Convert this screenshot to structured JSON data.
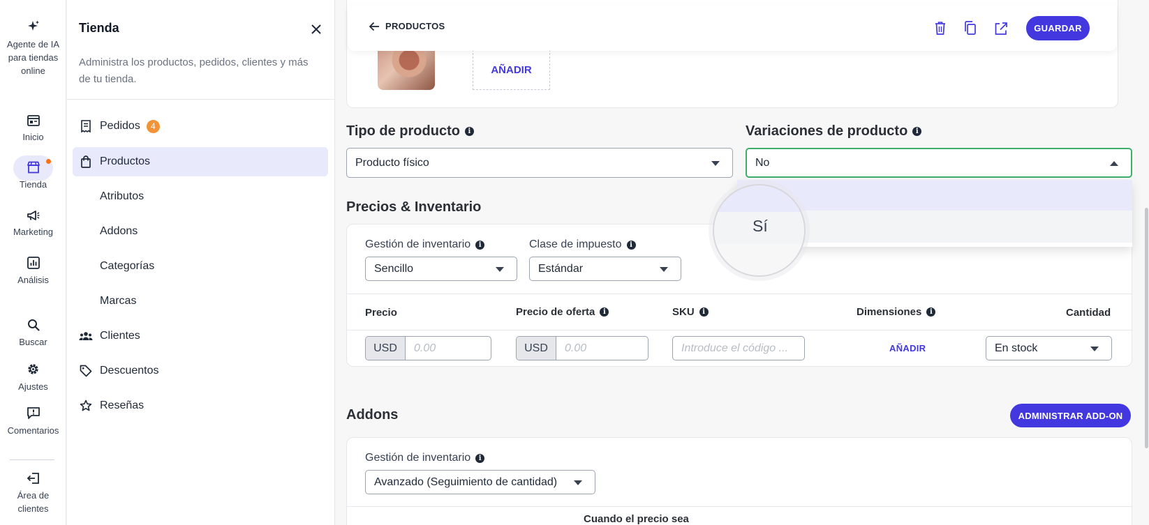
{
  "rail": {
    "items": [
      {
        "label": "Agente de IA para tiendas online",
        "icon": "sparkle-icon"
      },
      {
        "label": "Inicio",
        "icon": "home-dashboard-icon"
      },
      {
        "label": "Tienda",
        "icon": "store-icon"
      },
      {
        "label": "Marketing",
        "icon": "megaphone-icon"
      },
      {
        "label": "Análisis",
        "icon": "chart-icon"
      },
      {
        "label": "Buscar",
        "icon": "search-icon"
      },
      {
        "label": "Ajustes",
        "icon": "gear-icon"
      },
      {
        "label": "Comentarios",
        "icon": "feedback-icon"
      },
      {
        "label": "Área de clientes",
        "icon": "client-area-icon"
      }
    ]
  },
  "panel": {
    "title": "Tienda",
    "description": "Administra los productos, pedidos, clientes y más de tu tienda.",
    "nav": [
      {
        "label": "Pedidos",
        "badge": "4",
        "icon": "receipt-icon"
      },
      {
        "label": "Productos",
        "icon": "shopping-bag-icon"
      },
      {
        "label": "Atributos"
      },
      {
        "label": "Addons"
      },
      {
        "label": "Categorías"
      },
      {
        "label": "Marcas"
      },
      {
        "label": "Clientes",
        "icon": "users-icon"
      },
      {
        "label": "Descuentos",
        "icon": "tag-icon"
      },
      {
        "label": "Reseñas",
        "icon": "star-icon"
      }
    ]
  },
  "toolbar": {
    "back_label": "PRODUCTOS",
    "save_label": "GUARDAR"
  },
  "media": {
    "add_label": "AÑADIR"
  },
  "product_type": {
    "title": "Tipo de producto",
    "value": "Producto físico"
  },
  "variations": {
    "title": "Variaciones de producto",
    "value": "No",
    "options": [
      "No",
      "Sí"
    ],
    "magnified_option": "Sí"
  },
  "pricing": {
    "title": "Precios & Inventario",
    "inventory_label": "Gestión de inventario",
    "inventory_value": "Sencillo",
    "tax_label": "Clase de impuesto",
    "tax_value": "Estándar",
    "columns": {
      "price": "Precio",
      "sale_price": "Precio de oferta",
      "sku": "SKU",
      "dimensions": "Dimensiones",
      "quantity": "Cantidad"
    },
    "currency": "USD",
    "price_placeholder": "0.00",
    "sale_placeholder": "0.00",
    "sku_placeholder": "Introduce el código ...",
    "dimensions_add": "AÑADIR",
    "stock_value": "En stock"
  },
  "addons": {
    "title": "Addons",
    "manage_label": "ADMINISTRAR ADD-ON",
    "inventory_label": "Gestión de inventario",
    "inventory_value": "Avanzado (Seguimiento de cantidad)",
    "price_when": "Cuando el precio sea"
  },
  "colors": {
    "accent": "#4338e0",
    "focus": "#3fae6a",
    "badge": "#f29337",
    "active_bg": "#e8e9fb"
  }
}
